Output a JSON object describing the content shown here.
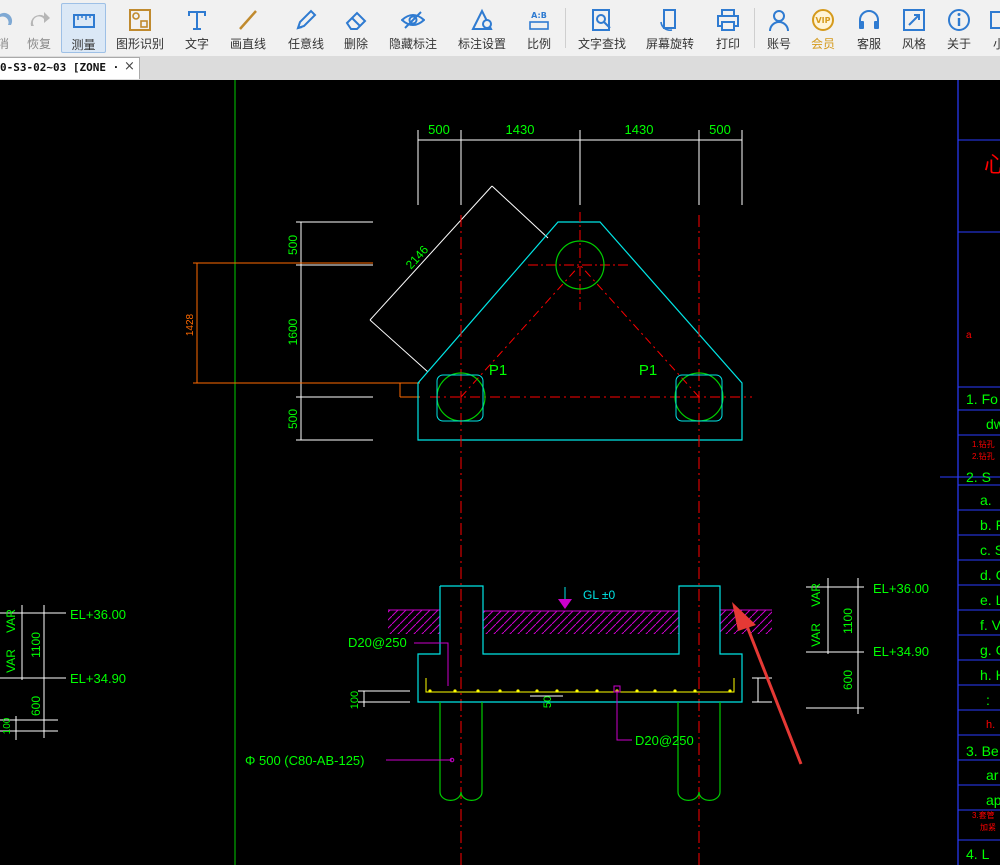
{
  "toolbar": {
    "items": [
      {
        "name": "undo",
        "label": "消",
        "icon": "undo-icon"
      },
      {
        "name": "redo",
        "label": "恢复",
        "icon": "redo-icon"
      },
      {
        "name": "measure",
        "label": "测量",
        "icon": "ruler-icon"
      },
      {
        "name": "shape-recognition",
        "label": "图形识别",
        "icon": "shape-recognition-icon"
      },
      {
        "name": "text",
        "label": "文字",
        "icon": "text-icon"
      },
      {
        "name": "line",
        "label": "画直线",
        "icon": "line-icon"
      },
      {
        "name": "freehand",
        "label": "任意线",
        "icon": "pen-icon"
      },
      {
        "name": "delete",
        "label": "删除",
        "icon": "eraser-icon"
      },
      {
        "name": "hide-annotation",
        "label": "隐藏标注",
        "icon": "eye-icon"
      },
      {
        "name": "annotation-settings",
        "label": "标注设置",
        "icon": "settings-icon"
      },
      {
        "name": "scale",
        "label": "比例",
        "icon": "scale-icon"
      },
      {
        "name": "text-search",
        "label": "文字查找",
        "icon": "search-doc-icon"
      },
      {
        "name": "screen-rotate",
        "label": "屏幕旋转",
        "icon": "rotate-icon"
      },
      {
        "name": "print",
        "label": "打印",
        "icon": "printer-icon"
      },
      {
        "name": "account",
        "label": "账号",
        "icon": "user-icon"
      },
      {
        "name": "vip",
        "label": "会员",
        "icon": "vip-icon",
        "vip_text": "VIP"
      },
      {
        "name": "service",
        "label": "客服",
        "icon": "headset-icon"
      },
      {
        "name": "style",
        "label": "风格",
        "icon": "style-icon"
      },
      {
        "name": "about",
        "label": "关于",
        "icon": "info-icon"
      },
      {
        "name": "minimize",
        "label": "小",
        "icon": "minimize-icon"
      }
    ],
    "scale_icon_text": "A:B"
  },
  "tab": {
    "title": "0-S3-02~03 [ZONE ·",
    "close": "×"
  },
  "colors": {
    "background": "#000000",
    "dimension": "#ffffff",
    "text_green": "#00ff00",
    "outline_cyan": "#00ffff",
    "centerline_red": "#ff0000",
    "hatch_magenta": "#cc00cc",
    "arrow": "#e53935"
  },
  "drawing": {
    "plan": {
      "top_dims": [
        "500",
        "1430",
        "1430",
        "500"
      ],
      "left_dims": [
        "500",
        "1600",
        "500"
      ],
      "overall_dim": "1428",
      "diagonal_dim": "2146",
      "pile_labels": [
        "P1",
        "P1"
      ]
    },
    "section": {
      "grade_label": "GL ±0",
      "rebar_top": "D20@250",
      "rebar_bottom": "D20@250",
      "pile_spec": "Φ 500 (C80-AB-125)",
      "dim_100": "100",
      "dim_50": "50",
      "left_detail": {
        "var1": "VAR",
        "var2": "VAR",
        "dim_1100": "1100",
        "dim_600": "600",
        "dim_100": "100",
        "el_top": "EL+36.00",
        "el_bottom": "EL+34.90"
      },
      "right_detail": {
        "var1": "VAR",
        "var2": "VAR",
        "dim_1100": "1100",
        "dim_600": "600",
        "el_top": "EL+36.00",
        "el_bottom": "EL+34.90"
      }
    },
    "notes_panel": {
      "items": [
        "1. Fo",
        "dw",
        "2. S",
        "a.",
        "b. F",
        "c. S",
        "d. C",
        "e. L",
        "f. V",
        "g. C",
        "h. H",
        ":",
        "h.",
        "3. Be",
        "ar",
        "ap",
        "4. L"
      ],
      "red_notes": [
        "1.钻孔",
        "2.钻孔",
        "3.套管",
        "加紧"
      ],
      "title_char": "心",
      "mark": "a"
    }
  }
}
